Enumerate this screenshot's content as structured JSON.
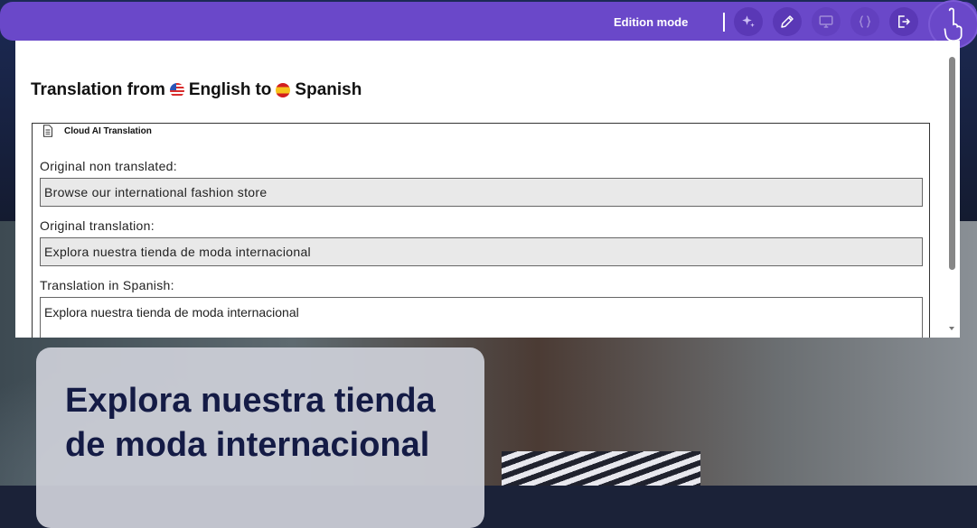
{
  "toolbar": {
    "mode_label": "Edition mode",
    "buttons": [
      {
        "icon": "sparkle-icon",
        "state": "active"
      },
      {
        "icon": "pencil-icon",
        "state": "active"
      },
      {
        "icon": "monitor-icon",
        "state": "inactive"
      },
      {
        "icon": "code-braces-icon",
        "state": "inactive"
      },
      {
        "icon": "logout-icon",
        "state": "active"
      }
    ],
    "avatar_icon": "hand-pointer-icon",
    "colors": {
      "bar": "#6a48c9",
      "button": "#5a38b6"
    }
  },
  "modal": {
    "title": {
      "prefix": "Translation from",
      "source_language": "English",
      "connector": "to",
      "target_language": "Spanish",
      "source_flag_icon": "us-flag-icon",
      "target_flag_icon": "spain-flag-icon"
    },
    "panel": {
      "legend": "Cloud AI Translation",
      "legend_icon": "document-icon"
    },
    "fields": {
      "original_label": "Original non translated:",
      "original_value": "Browse our international fashion store",
      "original_translation_label": "Original translation:",
      "original_translation_value": "Explora nuestra tienda de moda internacional",
      "translation_label": "Translation in Spanish:",
      "translation_value": "Explora nuestra tienda de moda internacional"
    }
  },
  "hero": {
    "title": "Explora nuestra tienda de moda internacional"
  }
}
